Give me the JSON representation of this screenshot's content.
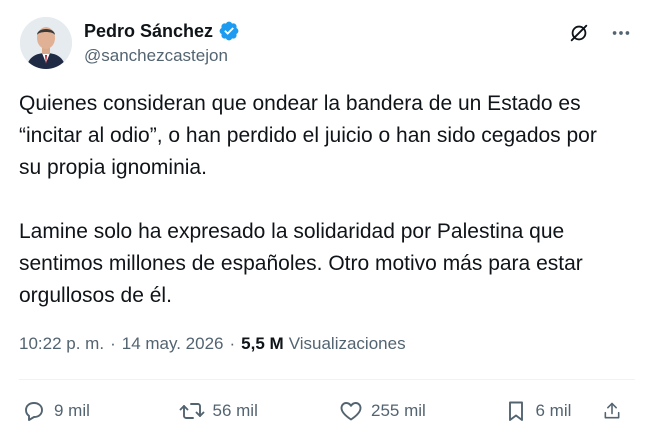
{
  "author": {
    "display_name": "Pedro Sánchez",
    "handle": "@sanchezcastejon",
    "verified": true,
    "verified_color": "#1d9bf0"
  },
  "tweet": {
    "paragraphs": [
      "Quienes consideran que ondear la bandera de un Estado es “incitar al odio”, o han perdido el juicio o han sido cegados por su propia ignominia.",
      "Lamine solo ha expresado la solidaridad por Palestina que sentimos millones de españoles. Otro motivo más para estar orgullosos de él."
    ]
  },
  "meta": {
    "time": "10:22 p. m.",
    "separator": "·",
    "date": "14 may. 2026",
    "views_count": "5,5 M",
    "views_label": "Visualizaciones"
  },
  "actions": {
    "replies": "9 mil",
    "reposts": "56 mil",
    "likes": "255 mil",
    "bookmarks": "6 mil"
  },
  "icons": [
    "grok-icon",
    "more-icon",
    "reply-icon",
    "repost-icon",
    "like-icon",
    "bookmark-icon",
    "share-icon",
    "verified-badge-icon"
  ],
  "colors": {
    "text": "#0f1419",
    "secondary": "#536471",
    "divider": "#eff3f4"
  }
}
